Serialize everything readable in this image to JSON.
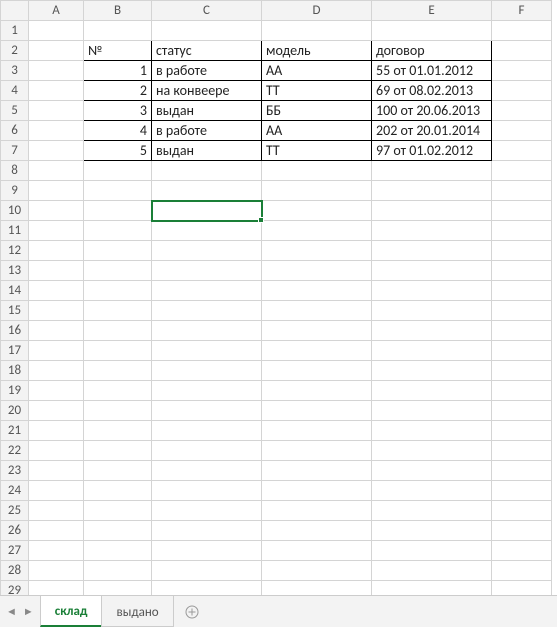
{
  "columns": [
    "A",
    "B",
    "C",
    "D",
    "E",
    "F"
  ],
  "active_column": "C",
  "active_row": 10,
  "row_count": 29,
  "table": {
    "headers": {
      "b": "№",
      "c": "статус",
      "d": "модель",
      "e": "договор"
    },
    "rows": [
      {
        "b": "1",
        "c": "в работе",
        "d": "АА",
        "e": "55 от 01.01.2012"
      },
      {
        "b": "2",
        "c": "на конвеере",
        "d": "ТТ",
        "e": "69 от 08.02.2013"
      },
      {
        "b": "3",
        "c": "выдан",
        "d": "ББ",
        "e": "100 от 20.06.2013"
      },
      {
        "b": "4",
        "c": "в работе",
        "d": "АА",
        "e": "202 от 20.01.2014"
      },
      {
        "b": "5",
        "c": "выдан",
        "d": "ТТ",
        "e": "97 от 01.02.2012"
      }
    ]
  },
  "tabs": {
    "items": [
      {
        "name": "склад",
        "active": true
      },
      {
        "name": "выдано",
        "active": false
      }
    ]
  },
  "nav": {
    "prev": "◄",
    "next": "►"
  }
}
